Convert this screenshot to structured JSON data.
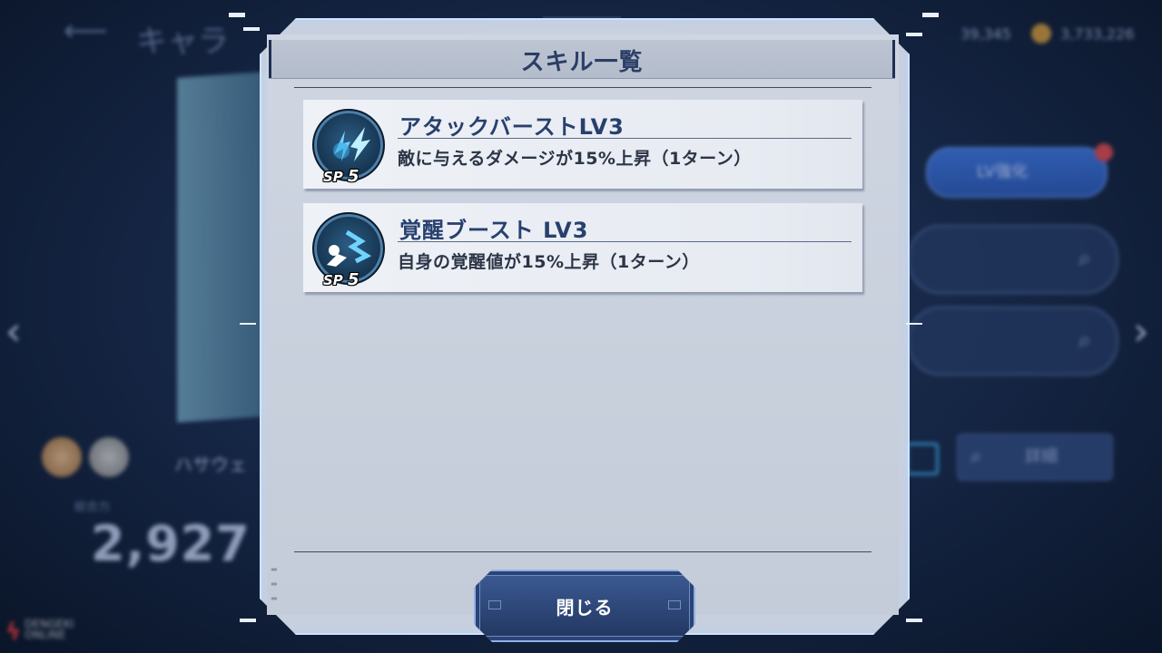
{
  "background": {
    "screen_title": "キャラ",
    "resources": [
      "39,345",
      "3,733,226"
    ],
    "lv_button_label": "LV強化",
    "detail_button_label": "詳細",
    "power_label": "総合力",
    "power_value": "2,927",
    "pilot_name": "ハサウェ",
    "watermark_line1": "DENGEKI",
    "watermark_line2": "ONLINE"
  },
  "dialog": {
    "title": "スキル一覧",
    "skills": [
      {
        "name": "アタックバーストLV3",
        "description": "敵に与えるダメージが15%上昇（1ターン）",
        "sp_label": "SP",
        "sp_cost": "5",
        "icon": "attack-burst-icon"
      },
      {
        "name": "覚醒ブースト LV3",
        "description": "自身の覚醒値が15%上昇（1ターン）",
        "sp_label": "SP",
        "sp_cost": "5",
        "icon": "awaken-boost-icon"
      }
    ],
    "close_label": "閉じる"
  },
  "colors": {
    "dialog_bg": "#cdd4e0",
    "title_text": "#2c3e66",
    "skill_name": "#27406e",
    "close_button": "#2c4679",
    "icon_bg": "#183855",
    "icon_glow": "#6fd3ff"
  }
}
